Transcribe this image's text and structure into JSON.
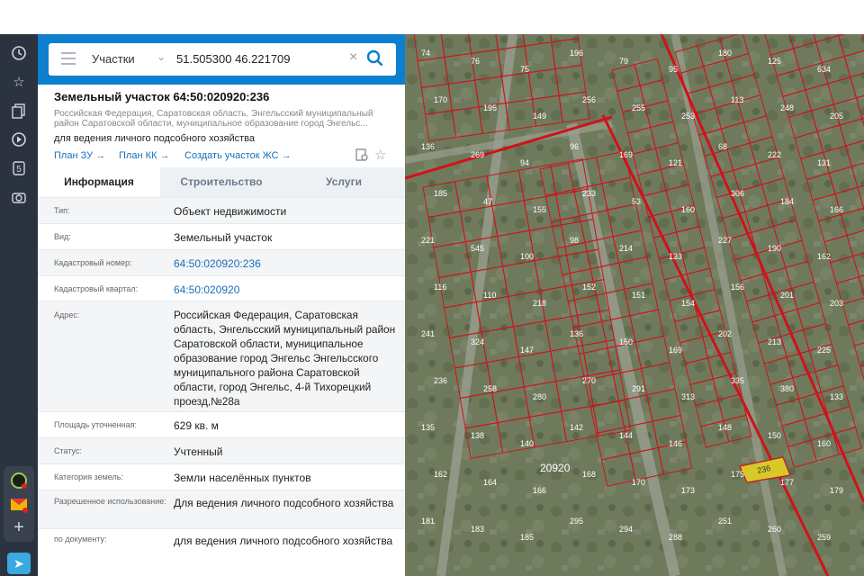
{
  "search": {
    "category": "Участки",
    "value": "51.505300 46.221709"
  },
  "parcel": {
    "title": "Земельный участок 64:50:020920:236",
    "address_short": "Российская Федерация, Саратовская область, Энгельсский муниципальный район Саратовской области, муниципальное образование город Энгельс...",
    "purpose": "для ведения личного подсобного хозяйства",
    "links": {
      "plan_zu": "План ЗУ →",
      "plan_kk": "План КК →",
      "create": "Создать участок ЖС →"
    }
  },
  "tabs": [
    "Информация",
    "Строительство",
    "Услуги"
  ],
  "properties": [
    {
      "label": "Тип:",
      "value": "Объект недвижимости"
    },
    {
      "label": "Вид:",
      "value": "Земельный участок"
    },
    {
      "label": "Кадастровый номер:",
      "value": "64:50:020920:236"
    },
    {
      "label": "Кадастровый квартал:",
      "value": "64:50:020920"
    },
    {
      "label": "Адрес:",
      "value": "Российская Федерация, Саратовская область, Энгельсский муниципальный район Саратовской области, муниципальное образование город Энгельс Энгельсского муниципального района Саратовской области, город Энгельс, 4-й Тихорецкий проезд,№28а"
    },
    {
      "label": "Площадь уточненная:",
      "value": "629 кв. м"
    },
    {
      "label": "Статус:",
      "value": "Учтенный"
    },
    {
      "label": "Категория земель:",
      "value": "Земли населённых пунктов"
    },
    {
      "label": "Разрешенное использование:",
      "value": "Для ведения личного подсобного хозяйства"
    },
    {
      "label": "по документу:",
      "value": "для ведения личного подсобного хозяйства"
    }
  ],
  "map": {
    "quarter_label": "20920",
    "selected_plot": "236",
    "plot_labels": [
      "74",
      "76",
      "75",
      "196",
      "79",
      "95",
      "180",
      "125",
      "634",
      "170",
      "195",
      "149",
      "256",
      "255",
      "253",
      "113",
      "248",
      "205",
      "136",
      "269",
      "94",
      "96",
      "169",
      "121",
      "68",
      "222",
      "131",
      "185",
      "47",
      "155",
      "233",
      "53",
      "160",
      "306",
      "184",
      "166",
      "221",
      "545",
      "100",
      "98",
      "214",
      "133",
      "227",
      "190",
      "162",
      "116",
      "110",
      "218",
      "152",
      "151",
      "154",
      "156",
      "201",
      "203",
      "241",
      "324",
      "147",
      "136",
      "150",
      "169",
      "202",
      "213",
      "225",
      "236",
      "258",
      "280",
      "270",
      "291",
      "313",
      "335",
      "380",
      "133",
      "135",
      "138",
      "140",
      "142",
      "144",
      "146",
      "148",
      "150",
      "160",
      "162",
      "164",
      "166",
      "168",
      "170",
      "173",
      "175",
      "177",
      "179",
      "181",
      "183",
      "185",
      "295",
      "294",
      "288",
      "251",
      "260",
      "259",
      "247",
      "238",
      "236",
      "115",
      "202",
      "203"
    ],
    "colors": {
      "boundary": "#d0121b",
      "selected_fill": "#d8c92a",
      "map_base": "#6f7a5c"
    }
  },
  "icons": [
    "clock-icon",
    "star-icon",
    "documents-icon",
    "play-icon",
    "number-5-icon",
    "camera-icon",
    "menu-icon",
    "chevron-down-icon",
    "clear-icon",
    "search-icon",
    "collapse-arrow-icon",
    "print-icon",
    "favorite-star-icon"
  ]
}
